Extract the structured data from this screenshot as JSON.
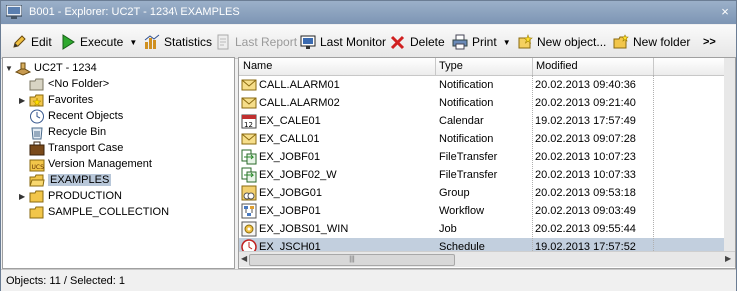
{
  "window": {
    "title": "B001 - Explorer: UC2T - 1234\\ EXAMPLES",
    "close_label": "×"
  },
  "toolbar": {
    "edit": "Edit",
    "execute": "Execute",
    "statistics": "Statistics",
    "last_report": "Last Report",
    "last_monitor": "Last Monitor",
    "delete": "Delete",
    "print": "Print",
    "new_object": "New object...",
    "new_folder": "New folder",
    "overflow": ">>"
  },
  "tree": {
    "root": "UC2T - 1234",
    "items": [
      {
        "label": "<No Folder>",
        "icon": "no-folder-icon"
      },
      {
        "label": "Favorites",
        "icon": "favorites-icon"
      },
      {
        "label": "Recent Objects",
        "icon": "recent-objects-icon"
      },
      {
        "label": "Recycle Bin",
        "icon": "recycle-bin-icon"
      },
      {
        "label": "Transport Case",
        "icon": "transport-case-icon"
      },
      {
        "label": "Version Management",
        "icon": "version-management-icon"
      },
      {
        "label": "EXAMPLES",
        "icon": "folder-open-icon"
      },
      {
        "label": "PRODUCTION",
        "icon": "folder-icon"
      },
      {
        "label": "SAMPLE_COLLECTION",
        "icon": "folder-icon"
      }
    ]
  },
  "list": {
    "columns": [
      "Name",
      "Type",
      "Modified"
    ],
    "rows": [
      {
        "name": "CALL.ALARM01",
        "type": "Notification",
        "modified": "20.02.2013 09:40:36",
        "icon": "notification-icon"
      },
      {
        "name": "CALL.ALARM02",
        "type": "Notification",
        "modified": "20.02.2013 09:21:40",
        "icon": "notification-icon"
      },
      {
        "name": "EX_CALE01",
        "type": "Calendar",
        "modified": "19.02.2013 17:57:49",
        "icon": "calendar-icon"
      },
      {
        "name": "EX_CALL01",
        "type": "Notification",
        "modified": "20.02.2013 09:07:28",
        "icon": "notification-icon"
      },
      {
        "name": "EX_JOBF01",
        "type": "FileTransfer",
        "modified": "20.02.2013 10:07:23",
        "icon": "filetransfer-icon"
      },
      {
        "name": "EX_JOBF02_W",
        "type": "FileTransfer",
        "modified": "20.02.2013 10:07:33",
        "icon": "filetransfer-icon"
      },
      {
        "name": "EX_JOBG01",
        "type": "Group",
        "modified": "20.02.2013 09:53:18",
        "icon": "group-icon"
      },
      {
        "name": "EX_JOBP01",
        "type": "Workflow",
        "modified": "20.02.2013 09:03:49",
        "icon": "workflow-icon"
      },
      {
        "name": "EX_JOBS01_WIN",
        "type": "Job",
        "modified": "20.02.2013 09:55:44",
        "icon": "job-icon"
      },
      {
        "name": "EX_JSCH01",
        "type": "Schedule",
        "modified": "19.02.2013 17:57:52",
        "icon": "schedule-icon"
      }
    ],
    "selected_index": 9
  },
  "status": {
    "text": "Objects: 11  / Selected: 1"
  },
  "colors": {
    "selection": "#c2cfde",
    "titlebar": "#8aa2c0"
  }
}
